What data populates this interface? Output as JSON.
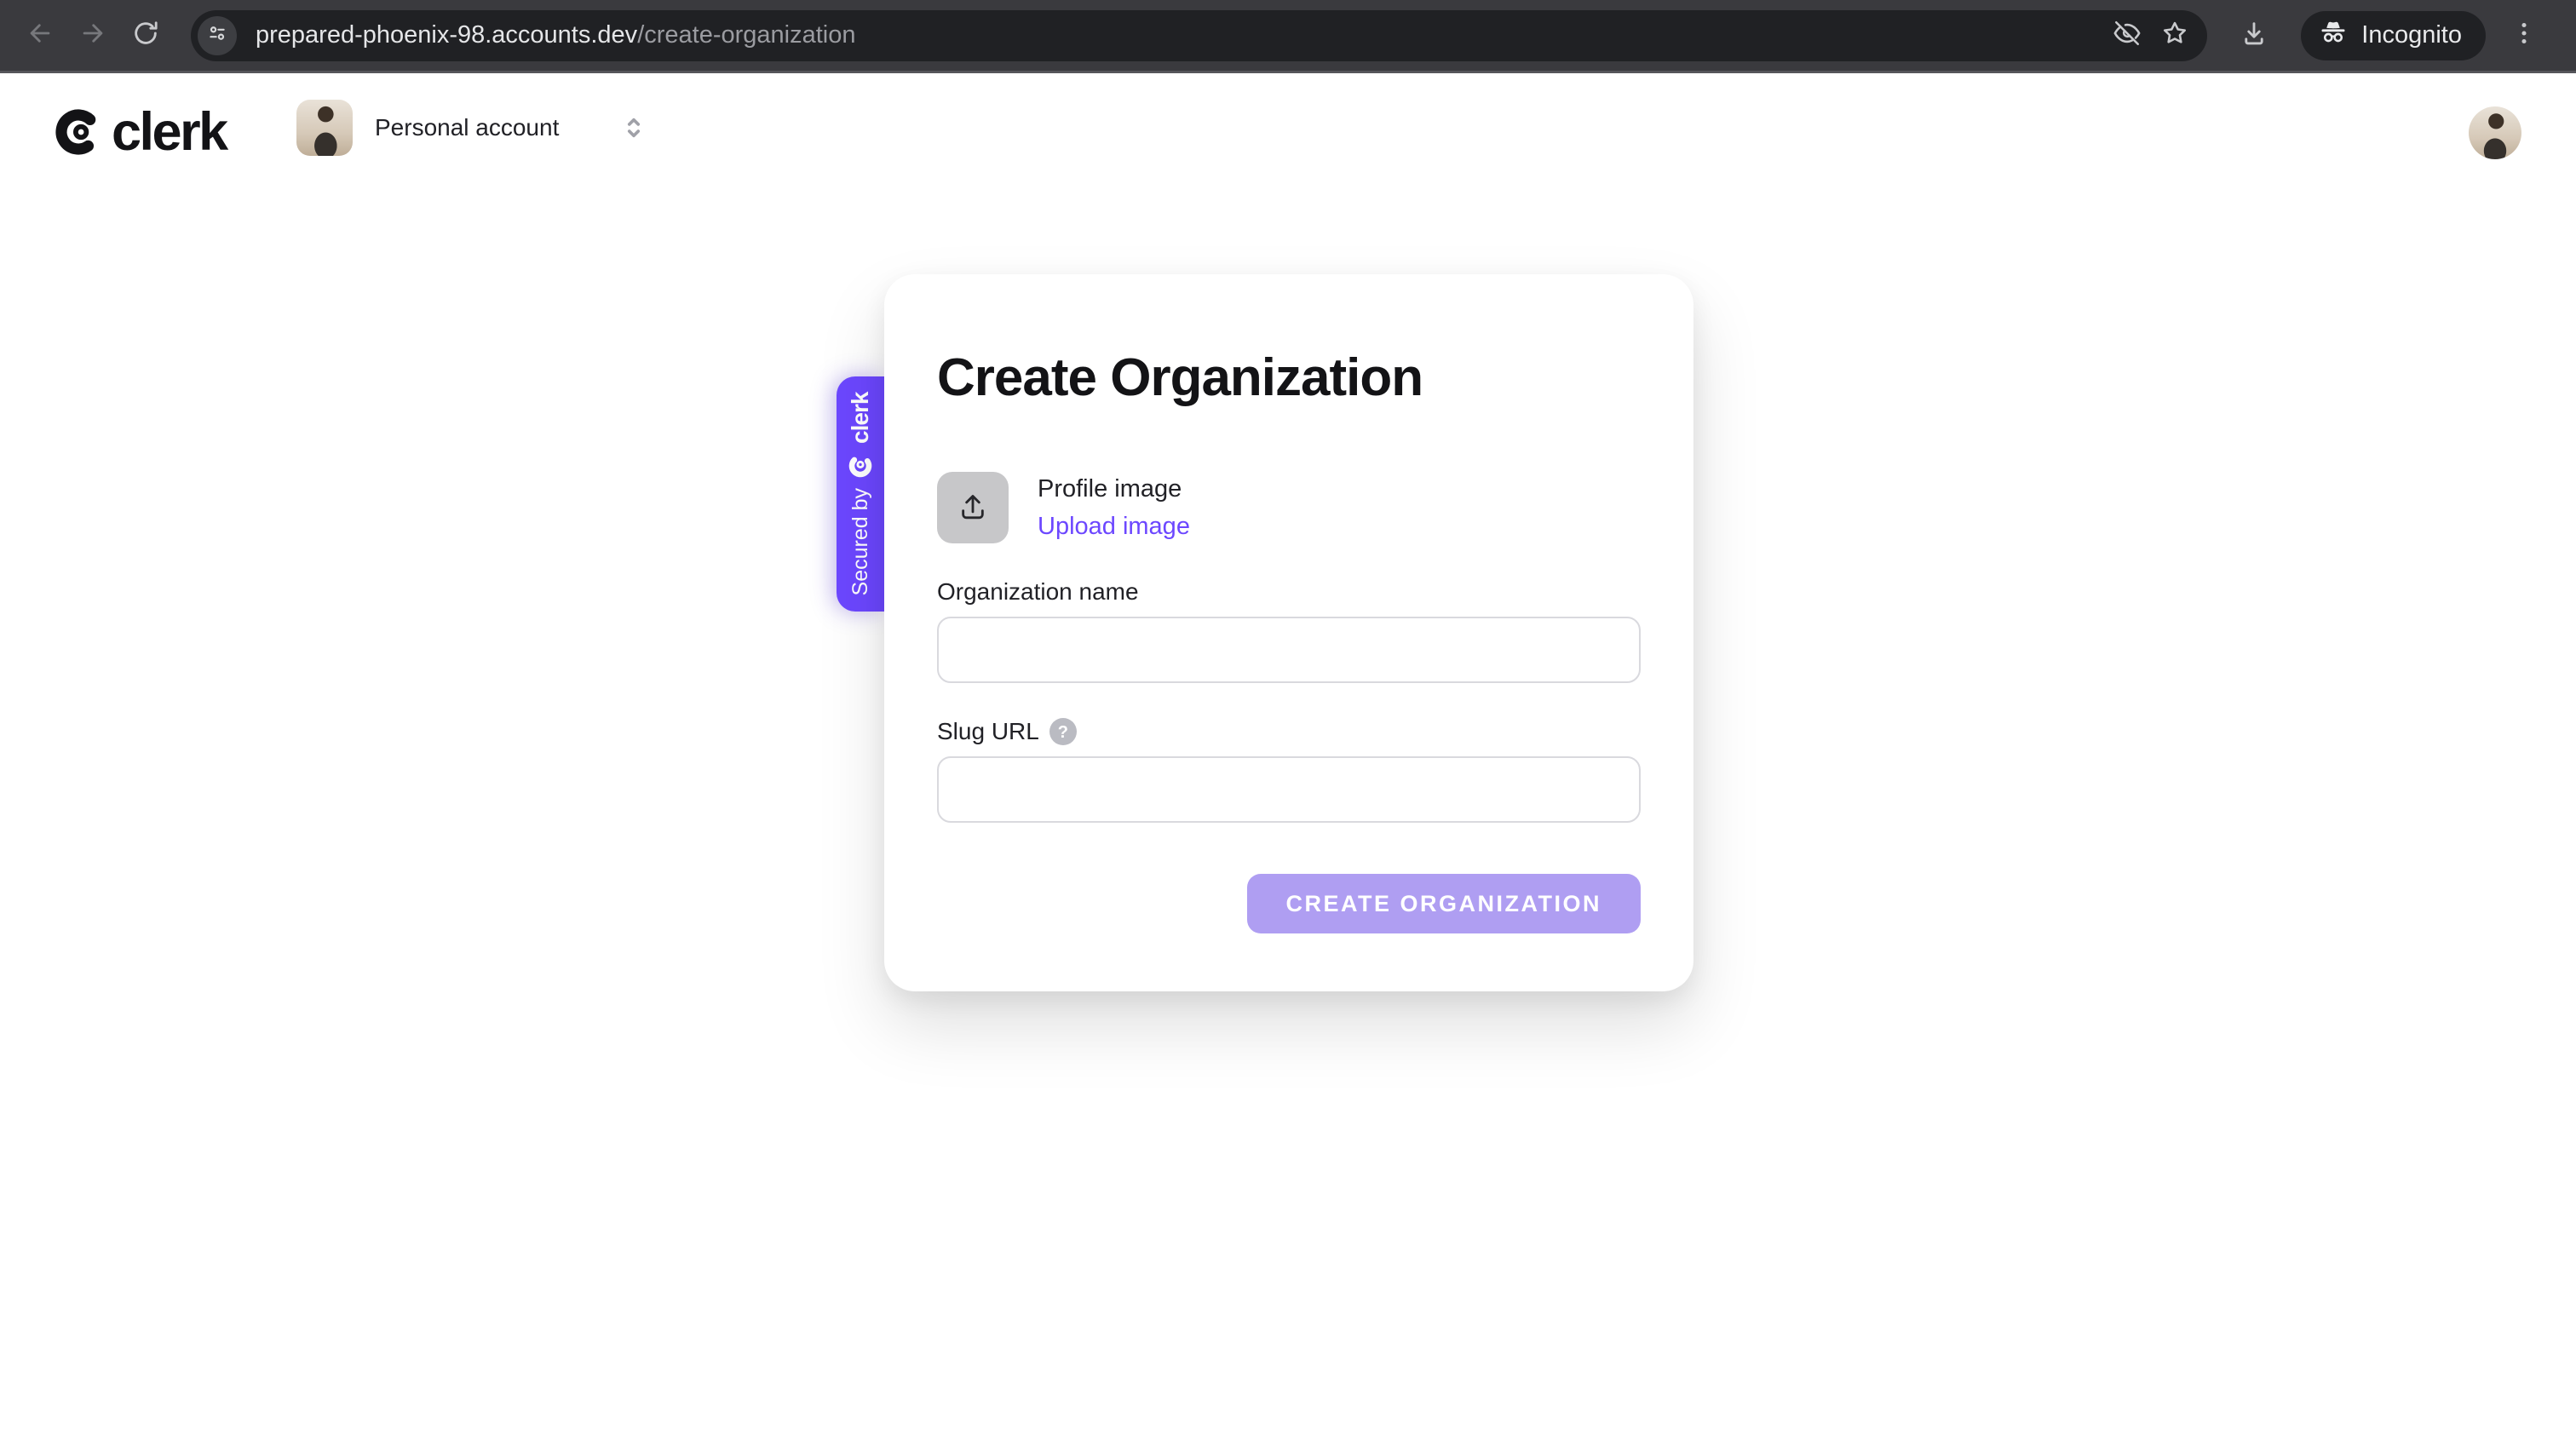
{
  "browser": {
    "url": {
      "domain": "prepared-phoenix-98.accounts.dev",
      "path": "/create-organization"
    },
    "incognito_label": "Incognito",
    "icons": [
      "back-arrow-icon",
      "forward-arrow-icon",
      "reload-icon",
      "site-controls-icon",
      "eye-off-icon",
      "star-icon",
      "download-icon",
      "incognito-icon",
      "kebab-menu-icon"
    ]
  },
  "header": {
    "brand_wordmark": "clerk",
    "account_switcher": {
      "label": "Personal account"
    }
  },
  "card": {
    "title": "Create Organization",
    "profile_image": {
      "label": "Profile image",
      "upload_link": "Upload image"
    },
    "fields": {
      "organization_name": {
        "label": "Organization name",
        "value": ""
      },
      "slug_url": {
        "label": "Slug URL",
        "help_glyph": "?",
        "value": ""
      }
    },
    "submit": {
      "label": "CREATE ORGANIZATION"
    }
  },
  "secured_badge": {
    "prefix": "Secured by",
    "brand": "clerk"
  },
  "colors": {
    "accent": "#6c47ff",
    "submit_disabled": "#af9ef2",
    "toolbar_bg": "#3a3a3e",
    "urlbar_bg": "#202124"
  }
}
